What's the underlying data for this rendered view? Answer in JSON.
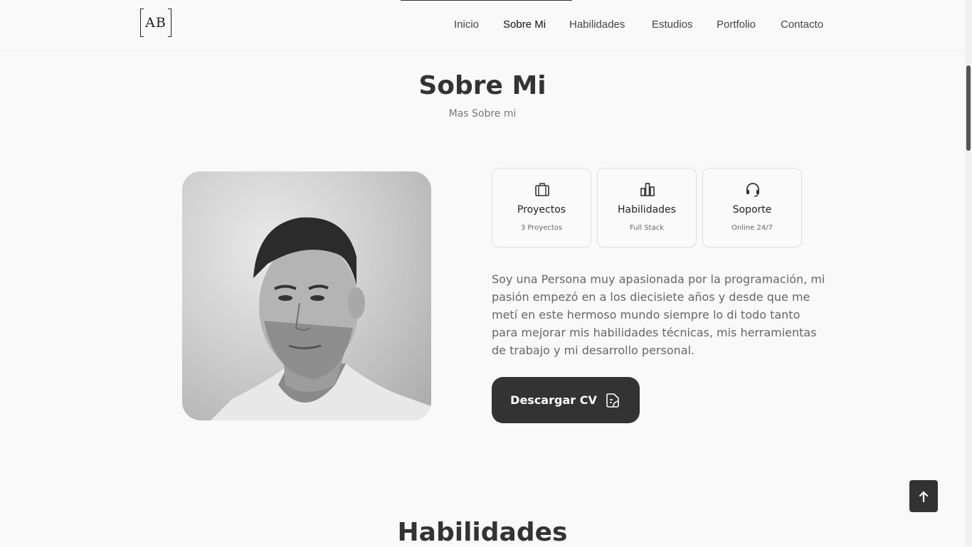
{
  "header": {
    "logo_text": "AB",
    "nav": [
      {
        "label": "Inicio"
      },
      {
        "label": "Sobre Mi"
      },
      {
        "label": "Habilidades"
      },
      {
        "label": "Estudios"
      },
      {
        "label": "Portfolio"
      },
      {
        "label": "Contacto"
      }
    ],
    "active_nav": "Sobre Mi"
  },
  "about": {
    "title": "Sobre Mi",
    "subtitle": "Mas Sobre mi",
    "cards": [
      {
        "icon": "briefcase-icon",
        "title": "Proyectos",
        "subtitle": "3 Proyectos"
      },
      {
        "icon": "bar-chart-icon",
        "title": "Habilidades",
        "subtitle": "Full Stack"
      },
      {
        "icon": "headset-icon",
        "title": "Soporte",
        "subtitle": "Online 24/7"
      }
    ],
    "description": "Soy una Persona muy apasionada por la programación, mi pasión empezó en a los diecisiete años y desde que me metí en este hermoso mundo siempre lo di todo tanto para mejorar mis habilidades técnicas, mis herramientas de trabajo y mi desarrollo personal.",
    "cv_button": "Descargar CV",
    "cv_icon": "document-icon"
  },
  "next_section": {
    "title": "Habilidades"
  },
  "scroll_top_icon": "arrow-up-icon",
  "colors": {
    "background": "#f9f9f9",
    "primary_dark": "#333333",
    "text_muted": "#666666"
  }
}
